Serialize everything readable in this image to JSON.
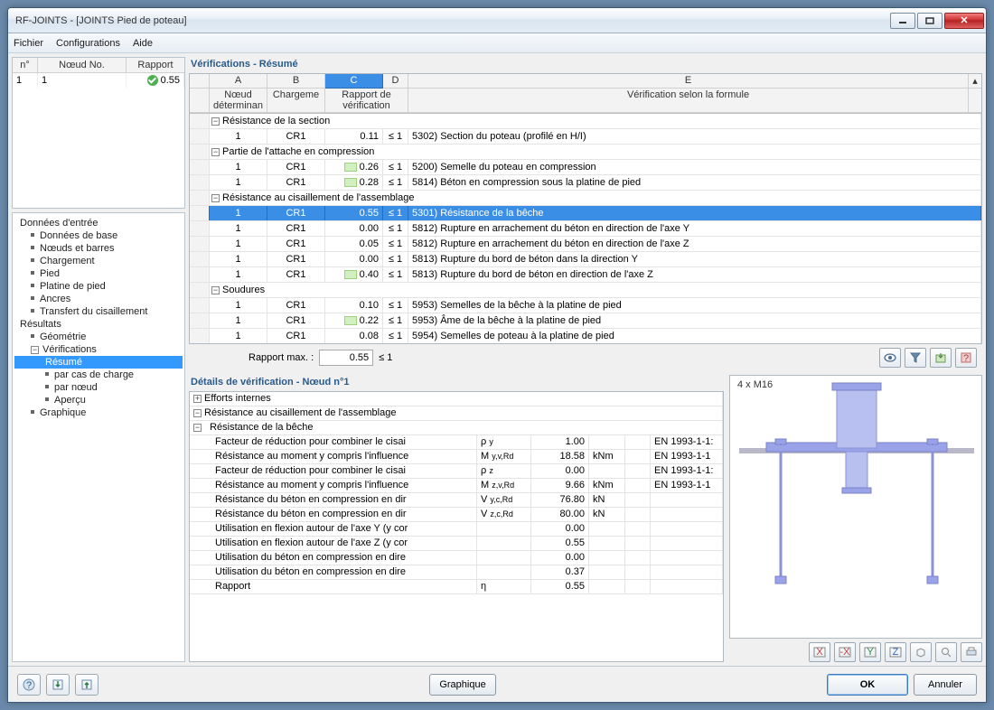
{
  "window": {
    "title": "RF-JOINTS - [JOINTS Pied de poteau]"
  },
  "menu": {
    "file": "Fichier",
    "config": "Configurations",
    "help": "Aide"
  },
  "small_table": {
    "headers": {
      "n": "n°",
      "node": "Nœud No.",
      "ratio": "Rapport"
    },
    "row": {
      "n": "1",
      "node": "1",
      "ratio": "0.55"
    }
  },
  "tree": {
    "input": "Données d'entrée",
    "base": "Données de base",
    "nodes": "Nœuds et barres",
    "load": "Chargement",
    "foot": "Pied",
    "plate": "Platine de pied",
    "anchors": "Ancres",
    "shear": "Transfert du cisaillement",
    "results": "Résultats",
    "geom": "Géométrie",
    "verif": "Vérifications",
    "resume": "Résumé",
    "bycase": "par cas de charge",
    "bynode": "par nœud",
    "overview": "Aperçu",
    "graph": "Graphique"
  },
  "verif_title": "Vérifications - Résumé",
  "grid_headers": {
    "A": "A",
    "B": "B",
    "C": "C",
    "D": "D",
    "E": "E",
    "node": "Nœud déterminan",
    "load": "Chargeme",
    "ratio": "Rapport de vérification",
    "desc": "Vérification selon la formule"
  },
  "groups": {
    "g1": "Résistance de la section",
    "g2": "Partie de l'attache en compression",
    "g3": "Résistance au cisaillement de l'assemblage",
    "g4": "Soudures"
  },
  "rows": [
    {
      "n": "1",
      "l": "CR1",
      "r": "0.11",
      "c": "≤ 1",
      "d": "5302) Section du poteau (profilé en H/I)"
    },
    {
      "n": "1",
      "l": "CR1",
      "r": "0.26",
      "c": "≤ 1",
      "d": "5200) Semelle du poteau en compression",
      "bar": true
    },
    {
      "n": "1",
      "l": "CR1",
      "r": "0.28",
      "c": "≤ 1",
      "d": "5814) Béton en compression sous la platine de pied",
      "bar": true
    },
    {
      "n": "1",
      "l": "CR1",
      "r": "0.55",
      "c": "≤ 1",
      "d": "5301) Résistance de la bêche",
      "sel": true
    },
    {
      "n": "1",
      "l": "CR1",
      "r": "0.00",
      "c": "≤ 1",
      "d": "5812) Rupture en arrachement du béton en direction de l'axe Y"
    },
    {
      "n": "1",
      "l": "CR1",
      "r": "0.05",
      "c": "≤ 1",
      "d": "5812) Rupture en arrachement du béton en direction de l'axe Z"
    },
    {
      "n": "1",
      "l": "CR1",
      "r": "0.00",
      "c": "≤ 1",
      "d": "5813) Rupture du bord de béton dans la direction Y"
    },
    {
      "n": "1",
      "l": "CR1",
      "r": "0.40",
      "c": "≤ 1",
      "d": "5813) Rupture du bord de béton en direction de l'axe Z",
      "bar": true
    },
    {
      "n": "1",
      "l": "CR1",
      "r": "0.10",
      "c": "≤ 1",
      "d": "5953) Semelles de la bêche à la platine de pied"
    },
    {
      "n": "1",
      "l": "CR1",
      "r": "0.22",
      "c": "≤ 1",
      "d": "5953) Âme de la bêche à la platine de pied",
      "bar": true
    },
    {
      "n": "1",
      "l": "CR1",
      "r": "0.08",
      "c": "≤ 1",
      "d": "5954) Semelles de poteau à la platine de pied"
    }
  ],
  "ratio_max": {
    "label": "Rapport max. :",
    "value": "0.55",
    "cond": "≤ 1"
  },
  "details_title": "Détails de vérification - Nœud n°1",
  "details": {
    "g1": "Efforts internes",
    "g2": "Résistance au cisaillement de l'assemblage",
    "g3": "Résistance de la bêche",
    "rows": [
      {
        "t": "Facteur de réduction pour combiner le cisai",
        "s": "ρ y",
        "v": "1.00",
        "u": "",
        "ref": "EN 1993-1-1:"
      },
      {
        "t": "Résistance au moment y compris l'influence",
        "s": "M y,v,Rd",
        "v": "18.58",
        "u": "kNm",
        "ref": "EN 1993-1-1"
      },
      {
        "t": "Facteur de réduction pour combiner le cisai",
        "s": "ρ z",
        "v": "0.00",
        "u": "",
        "ref": "EN 1993-1-1:"
      },
      {
        "t": "Résistance au moment y compris l'influence",
        "s": "M z,v,Rd",
        "v": "9.66",
        "u": "kNm",
        "ref": "EN 1993-1-1"
      },
      {
        "t": "Résistance du béton en compression en dir",
        "s": "V y,c,Rd",
        "v": "76.80",
        "u": "kN",
        "ref": ""
      },
      {
        "t": "Résistance du béton en compression en dir",
        "s": "V z,c,Rd",
        "v": "80.00",
        "u": "kN",
        "ref": ""
      },
      {
        "t": "Utilisation en flexion autour de l'axe Y (y cor",
        "s": "",
        "v": "0.00",
        "u": "",
        "ref": ""
      },
      {
        "t": "Utilisation en flexion autour de l'axe Z (y cor",
        "s": "",
        "v": "0.55",
        "u": "",
        "ref": ""
      },
      {
        "t": "Utilisation du béton en compression en dire",
        "s": "",
        "v": "0.00",
        "u": "",
        "ref": ""
      },
      {
        "t": "Utilisation du béton en compression en dire",
        "s": "",
        "v": "0.37",
        "u": "",
        "ref": ""
      },
      {
        "t": "Rapport",
        "s": "η",
        "v": "0.55",
        "u": "",
        "ref": ""
      }
    ]
  },
  "preview_label": "4 x M16",
  "footer": {
    "graph": "Graphique",
    "ok": "OK",
    "cancel": "Annuler"
  }
}
